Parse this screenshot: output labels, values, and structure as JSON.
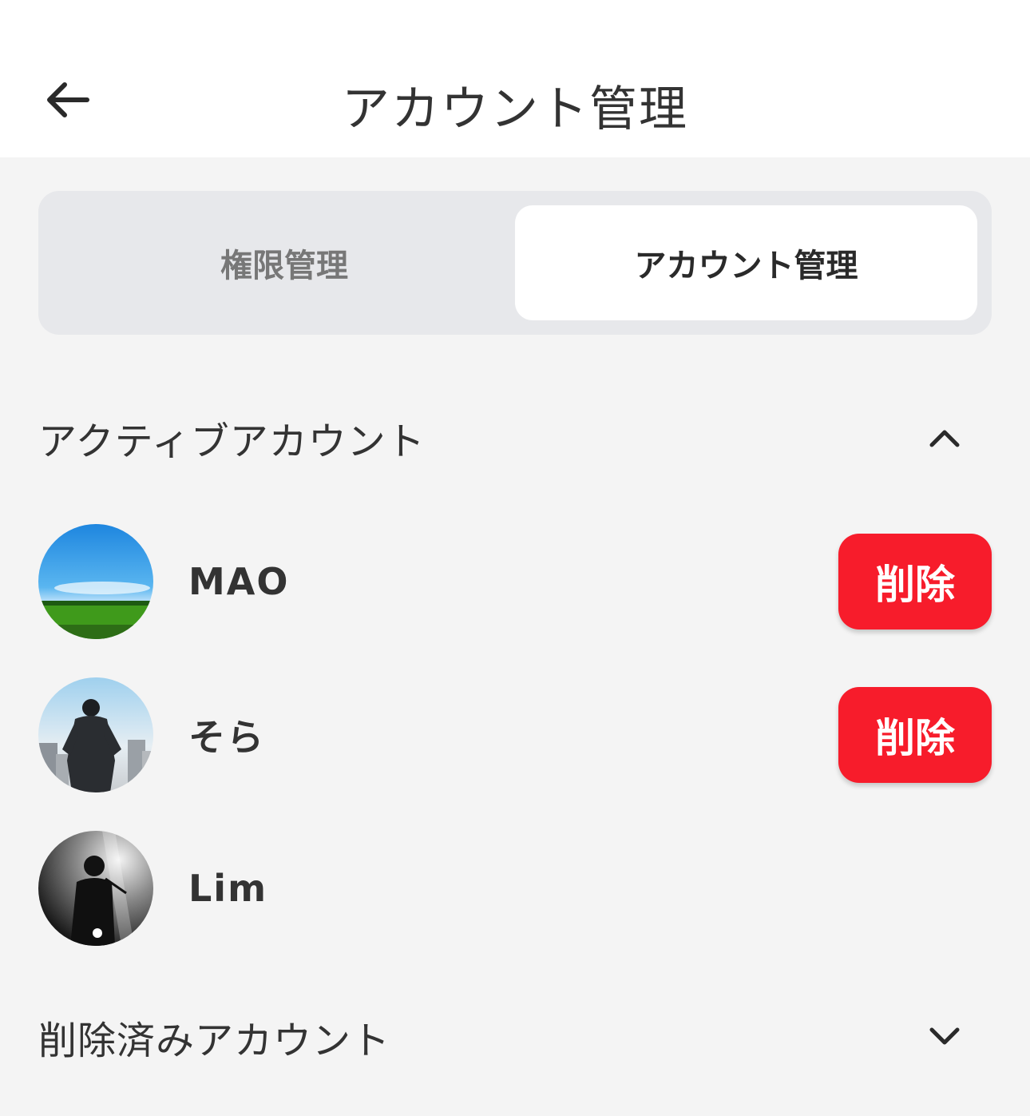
{
  "header": {
    "title": "アカウント管理",
    "back_icon": "arrow-left-icon"
  },
  "tabs": [
    {
      "label": "権限管理",
      "selected": false
    },
    {
      "label": "アカウント管理",
      "selected": true
    }
  ],
  "active_section": {
    "title": "アクティブアカウント",
    "expanded": true,
    "accounts": [
      {
        "name": "MAO",
        "delete_label": "削除"
      },
      {
        "name": "そら",
        "delete_label": "削除"
      },
      {
        "name": "Lim"
      }
    ]
  },
  "deleted_section": {
    "title": "削除済みアカウント",
    "expanded": false
  },
  "colors": {
    "delete": "#f71c2b",
    "background": "#f4f4f4",
    "segment": "#e7e8eb"
  }
}
